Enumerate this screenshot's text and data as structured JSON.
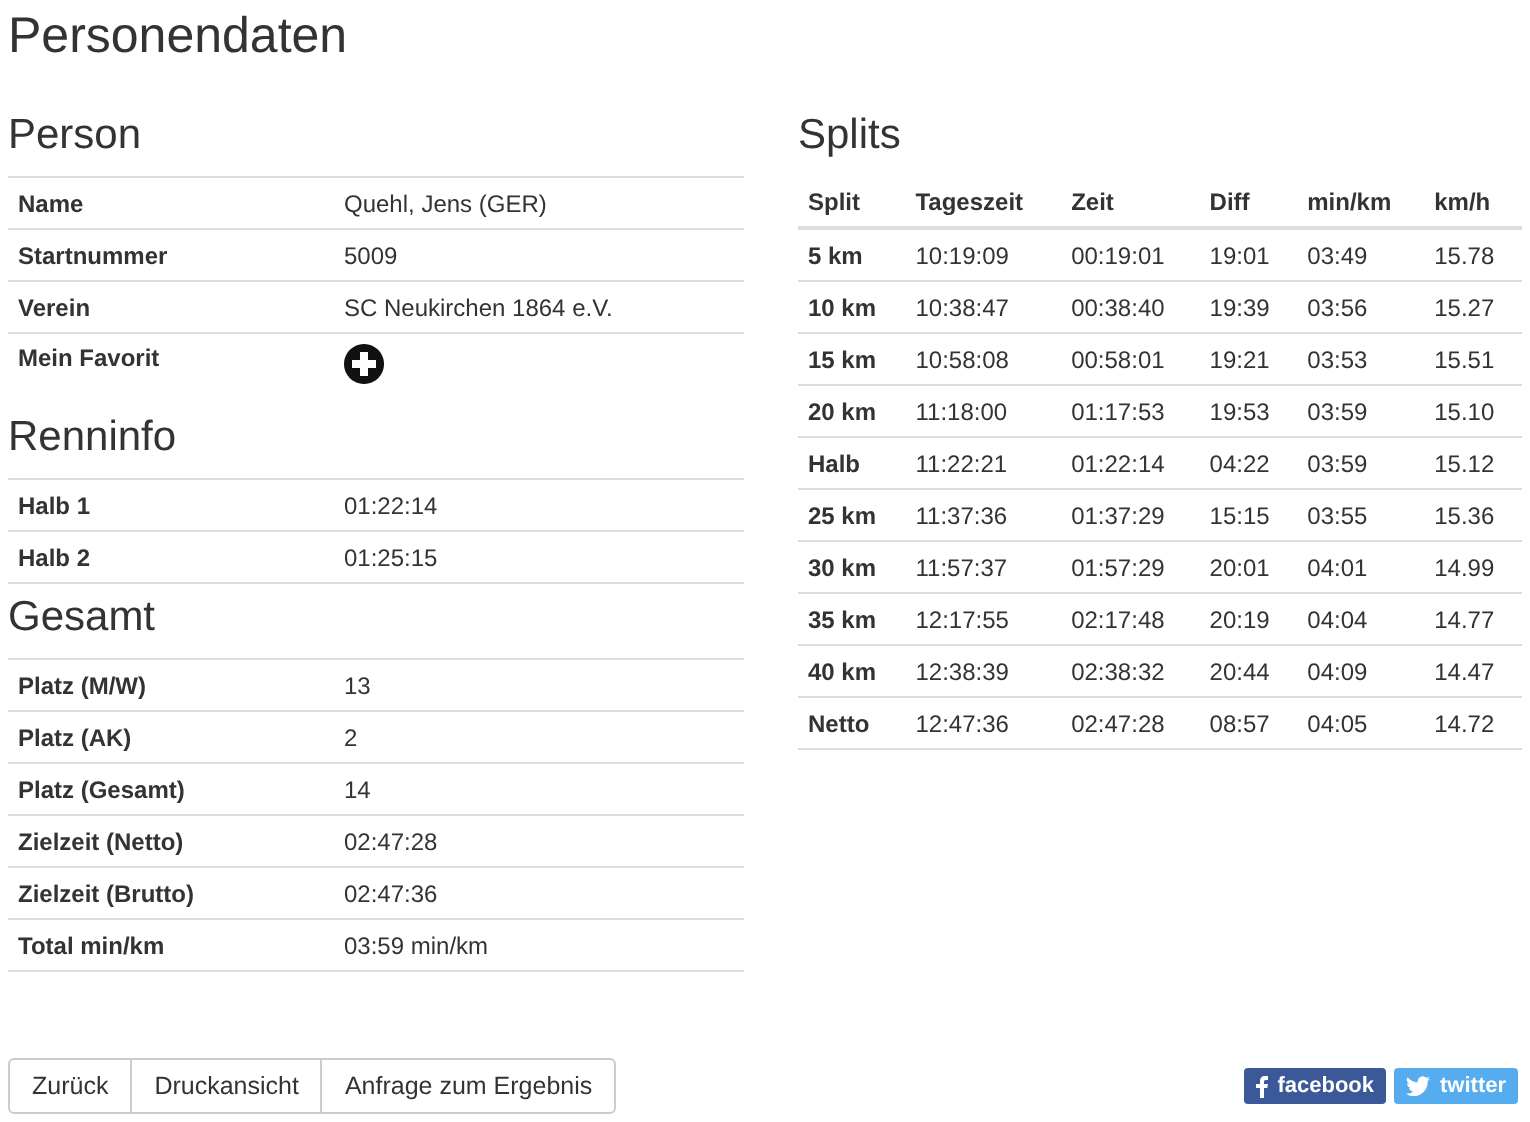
{
  "title": "Personendaten",
  "sections": [
    {
      "heading": "Person",
      "rows": [
        {
          "kind": "text",
          "label": "Name",
          "value": "Quehl, Jens (GER)"
        },
        {
          "kind": "text",
          "label": "Startnummer",
          "value": "5009"
        },
        {
          "kind": "text",
          "label": "Verein",
          "value": "SC Neukirchen 1864 e.V."
        },
        {
          "kind": "favorite",
          "label": "Mein Favorit"
        }
      ]
    },
    {
      "heading": "Renninfo",
      "rows": [
        {
          "kind": "text",
          "label": "Halb 1",
          "value": "01:22:14"
        },
        {
          "kind": "text",
          "label": "Halb 2",
          "value": "01:25:15"
        }
      ]
    },
    {
      "heading": "Gesamt",
      "rows": [
        {
          "kind": "text",
          "label": "Platz (M/W)",
          "value": "13"
        },
        {
          "kind": "text",
          "label": "Platz (AK)",
          "value": "2"
        },
        {
          "kind": "text",
          "label": "Platz (Gesamt)",
          "value": "14"
        },
        {
          "kind": "text",
          "label": "Zielzeit (Netto)",
          "value": "02:47:28"
        },
        {
          "kind": "text",
          "label": "Zielzeit (Brutto)",
          "value": "02:47:36"
        },
        {
          "kind": "text",
          "label": "Total min/km",
          "value": "03:59 min/km"
        }
      ]
    }
  ],
  "splits": {
    "heading": "Splits",
    "columns": [
      "Split",
      "Tageszeit",
      "Zeit",
      "Diff",
      "min/km",
      "km/h"
    ],
    "rows": [
      [
        "5 km",
        "10:19:09",
        "00:19:01",
        "19:01",
        "03:49",
        "15.78"
      ],
      [
        "10 km",
        "10:38:47",
        "00:38:40",
        "19:39",
        "03:56",
        "15.27"
      ],
      [
        "15 km",
        "10:58:08",
        "00:58:01",
        "19:21",
        "03:53",
        "15.51"
      ],
      [
        "20 km",
        "11:18:00",
        "01:17:53",
        "19:53",
        "03:59",
        "15.10"
      ],
      [
        "Halb",
        "11:22:21",
        "01:22:14",
        "04:22",
        "03:59",
        "15.12"
      ],
      [
        "25 km",
        "11:37:36",
        "01:37:29",
        "15:15",
        "03:55",
        "15.36"
      ],
      [
        "30 km",
        "11:57:37",
        "01:57:29",
        "20:01",
        "04:01",
        "14.99"
      ],
      [
        "35 km",
        "12:17:55",
        "02:17:48",
        "20:19",
        "04:04",
        "14.77"
      ],
      [
        "40 km",
        "12:38:39",
        "02:38:32",
        "20:44",
        "04:09",
        "14.47"
      ],
      [
        "Netto",
        "12:47:36",
        "02:47:28",
        "08:57",
        "04:05",
        "14.72"
      ]
    ]
  },
  "buttons": [
    "Zurück",
    "Druckansicht",
    "Anfrage zum Ergebnis"
  ],
  "share": [
    {
      "kind": "facebook",
      "label": "facebook"
    },
    {
      "kind": "twitter",
      "label": "twitter"
    }
  ]
}
